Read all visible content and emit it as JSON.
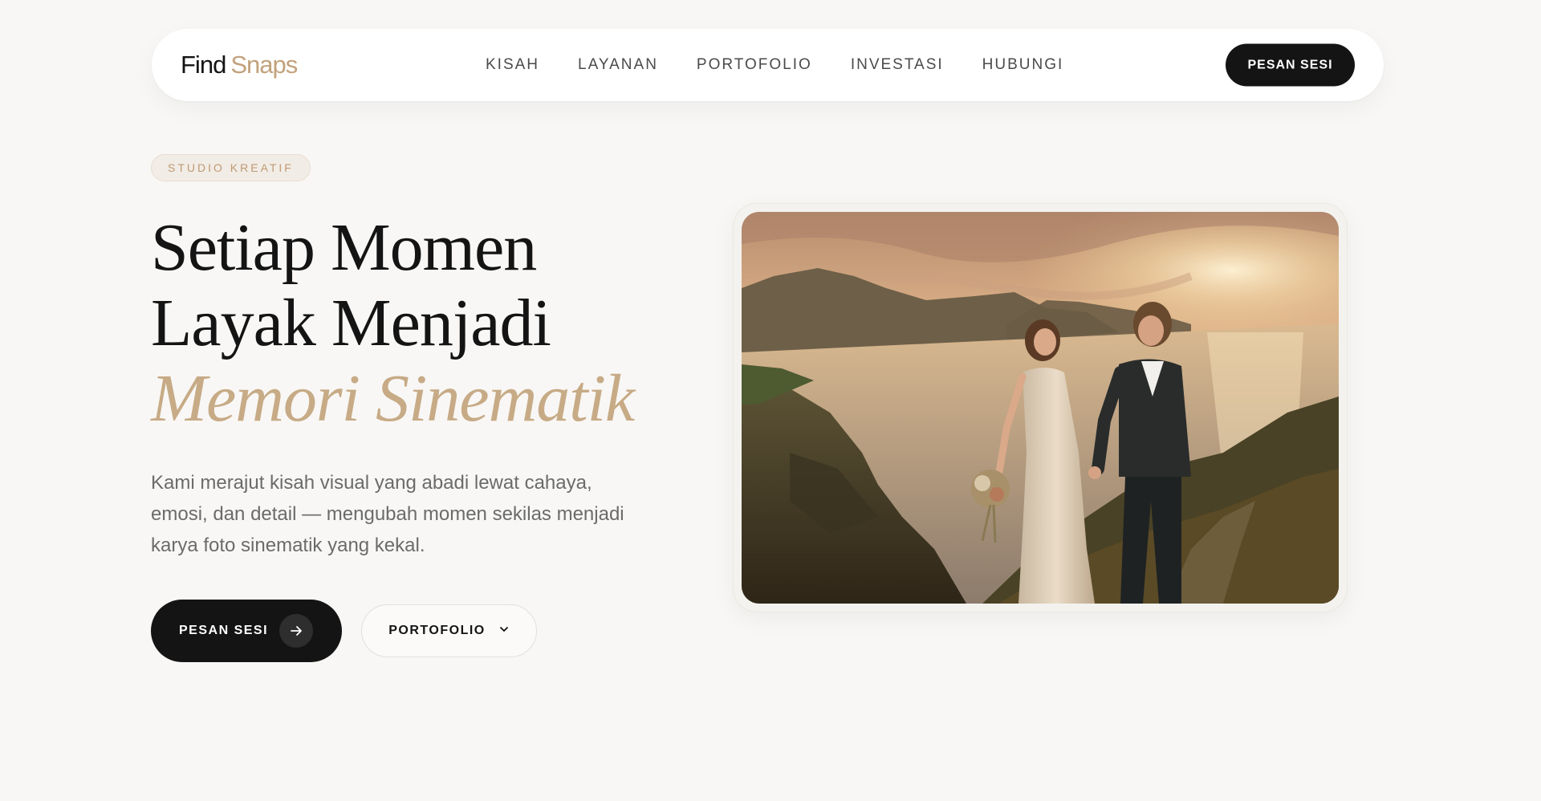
{
  "nav": {
    "brand_part1": "Find",
    "brand_part2": "Snaps",
    "items": [
      {
        "label": "KISAH"
      },
      {
        "label": "LAYANAN"
      },
      {
        "label": "PORTOFOLIO"
      },
      {
        "label": "INVESTASI"
      },
      {
        "label": "HUBUNGI"
      }
    ],
    "cta_label": "PESAN SESI"
  },
  "hero": {
    "badge": "STUDIO KREATIF",
    "headline_line1": "Setiap Momen",
    "headline_line2": "Layak Menjadi",
    "headline_accent": "Memori Sinematik",
    "description": "Kami merajut kisah visual yang abadi lewat cahaya, emosi, dan detail — mengubah momen sekilas menjadi karya foto sinematik yang kekal.",
    "primary_button": "PESAN SESI",
    "primary_button_icon": "arrow-right-icon",
    "secondary_button": "PORTOFOLIO",
    "secondary_button_icon": "chevron-down-icon"
  },
  "colors": {
    "background": "#f8f7f5",
    "ink": "#141414",
    "accent_gold": "#c7ab86",
    "muted_text": "#6b6b6b"
  }
}
